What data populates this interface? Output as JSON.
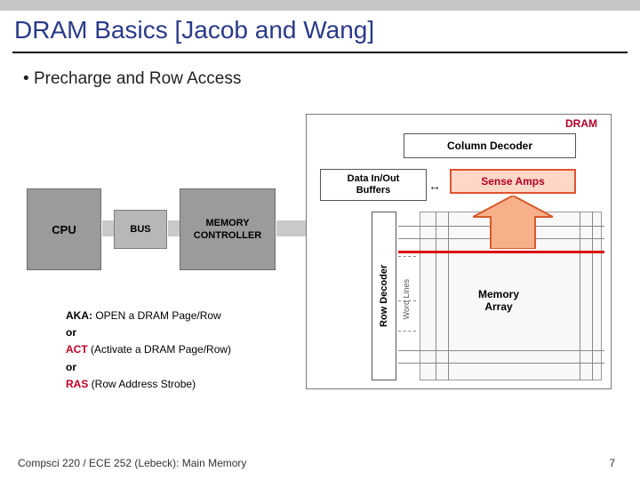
{
  "slide": {
    "title": "DRAM Basics [Jacob and Wang]",
    "bullet": "Precharge and Row Access",
    "page_number": "7"
  },
  "footer": {
    "course": "Compsci 220 / ECE 252 (Lebeck): Main Memory"
  },
  "diagram": {
    "dram_label": "DRAM",
    "cpu": "CPU",
    "bus": "BUS",
    "memory_controller": "MEMORY\nCONTROLLER",
    "column_decoder": "Column Decoder",
    "data_buffers": "Data In/Out\nBuffers",
    "sense_amps": "Sense Amps",
    "row_decoder": "Row Decoder",
    "word_lines": "Word Lines",
    "memory_array": "Memory\nArray",
    "biarrow": "↔"
  },
  "aka": {
    "line1_prefix": "AKA:",
    "line1_rest": " OPEN a DRAM Page/Row",
    "or": "or",
    "act": "ACT",
    "act_rest": " (Activate a DRAM Page/Row)",
    "ras": "RAS",
    "ras_rest": " (Row Address Strobe)"
  }
}
